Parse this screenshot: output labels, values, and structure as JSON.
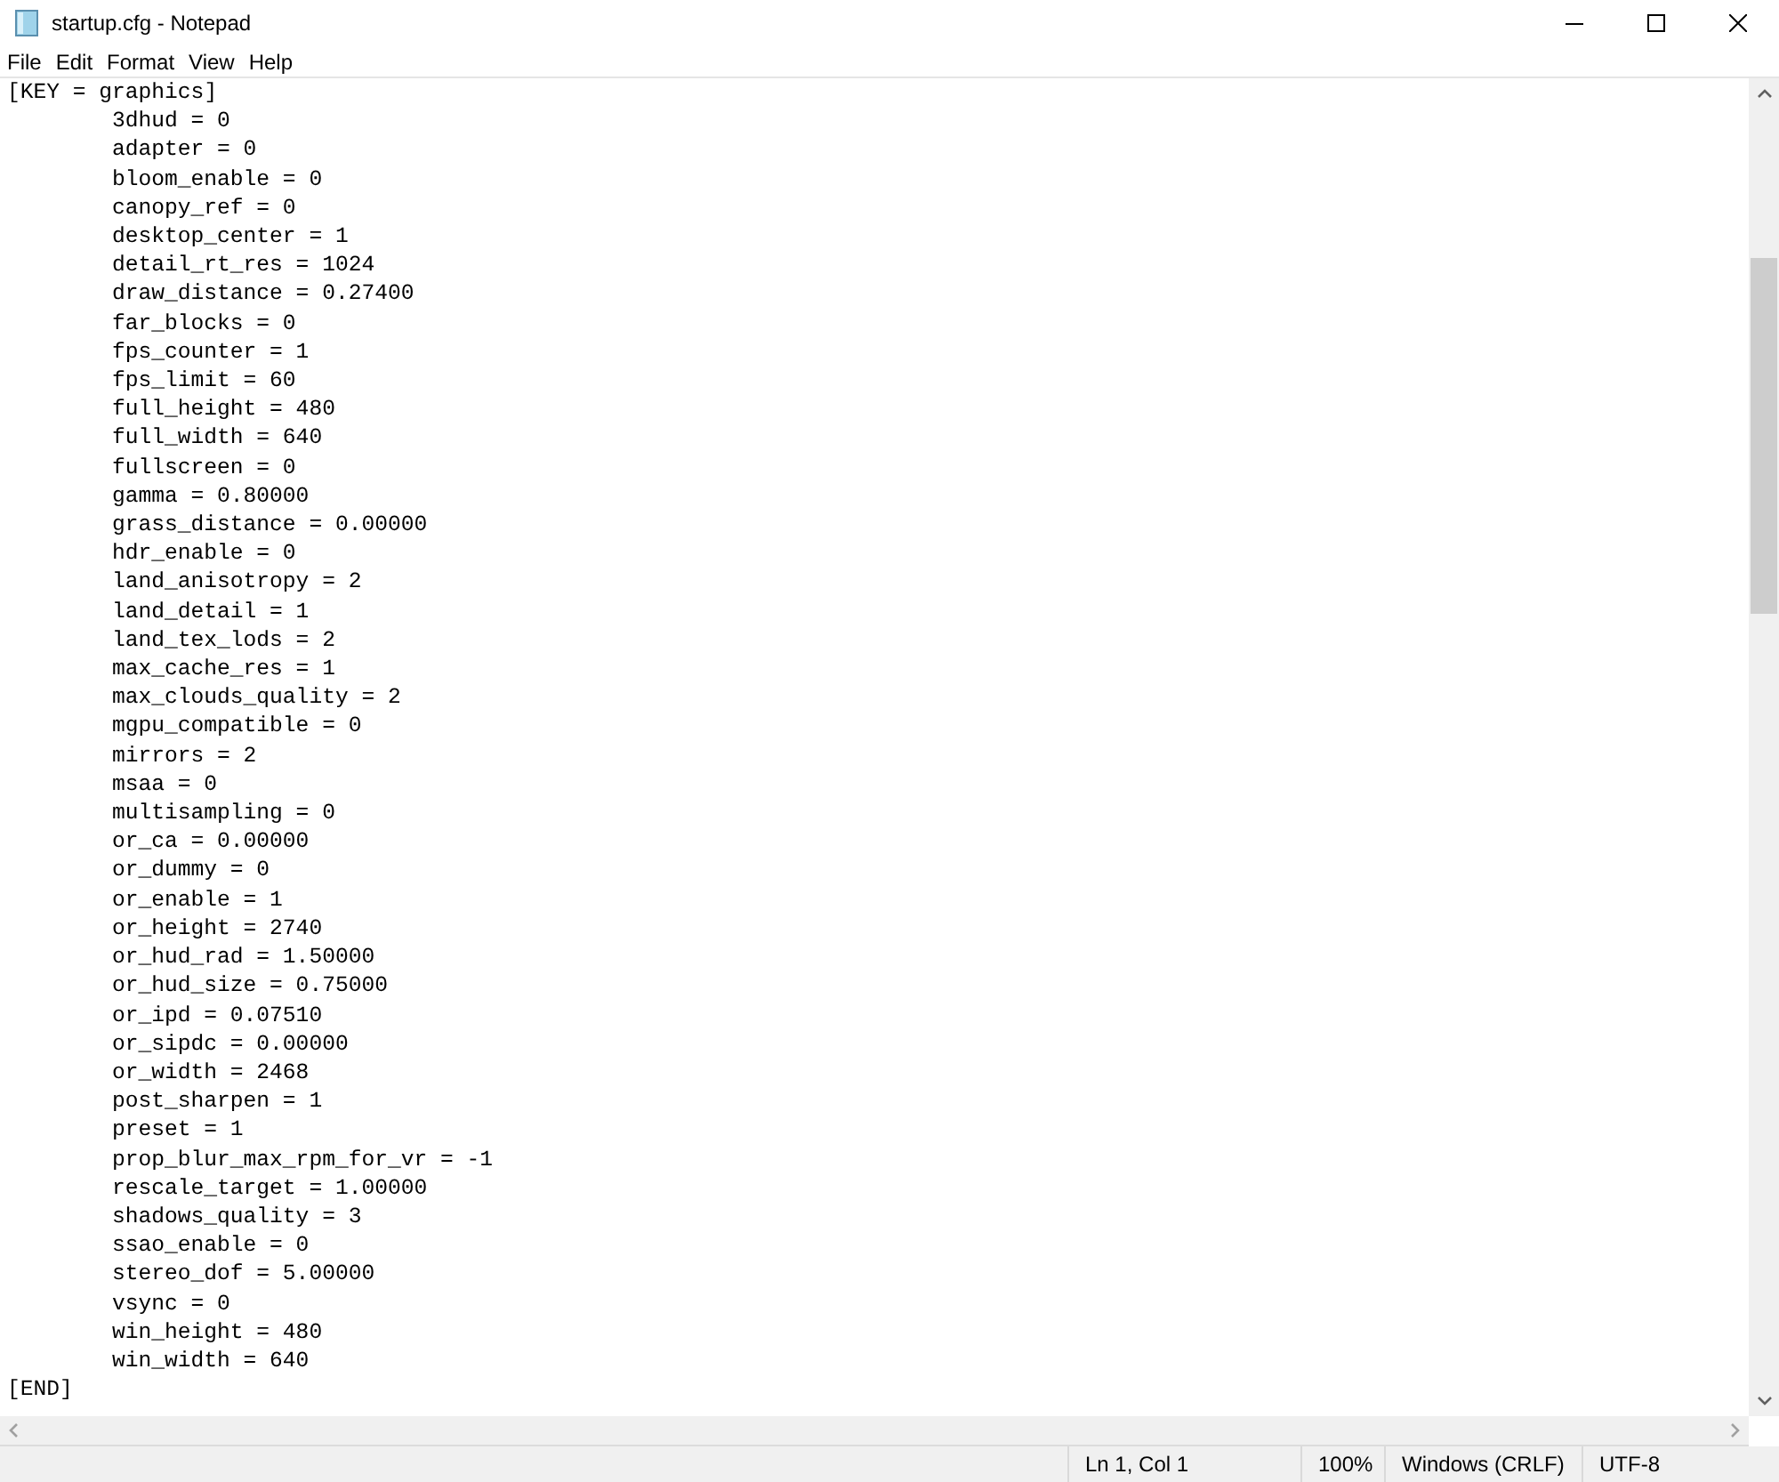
{
  "window": {
    "title": "startup.cfg - Notepad"
  },
  "menu": [
    "File",
    "Edit",
    "Format",
    "View",
    "Help"
  ],
  "document": {
    "header": "[KEY = graphics]",
    "entries": [
      "3dhud = 0",
      "adapter = 0",
      "bloom_enable = 0",
      "canopy_ref = 0",
      "desktop_center = 1",
      "detail_rt_res = 1024",
      "draw_distance = 0.27400",
      "far_blocks = 0",
      "fps_counter = 1",
      "fps_limit = 60",
      "full_height = 480",
      "full_width = 640",
      "fullscreen = 0",
      "gamma = 0.80000",
      "grass_distance = 0.00000",
      "hdr_enable = 0",
      "land_anisotropy = 2",
      "land_detail = 1",
      "land_tex_lods = 2",
      "max_cache_res = 1",
      "max_clouds_quality = 2",
      "mgpu_compatible = 0",
      "mirrors = 2",
      "msaa = 0",
      "multisampling = 0",
      "or_ca = 0.00000",
      "or_dummy = 0",
      "or_enable = 1",
      "or_height = 2740",
      "or_hud_rad = 1.50000",
      "or_hud_size = 0.75000",
      "or_ipd = 0.07510",
      "or_sipdc = 0.00000",
      "or_width = 2468",
      "post_sharpen = 1",
      "preset = 1",
      "prop_blur_max_rpm_for_vr = -1",
      "rescale_target = 1.00000",
      "shadows_quality = 3",
      "ssao_enable = 0",
      "stereo_dof = 5.00000",
      "vsync = 0",
      "win_height = 480",
      "win_width = 640"
    ],
    "footer": "[END]"
  },
  "status_bar": [
    "Ln 1, Col 1",
    "100%",
    "Windows (CRLF)",
    "UTF-8"
  ]
}
